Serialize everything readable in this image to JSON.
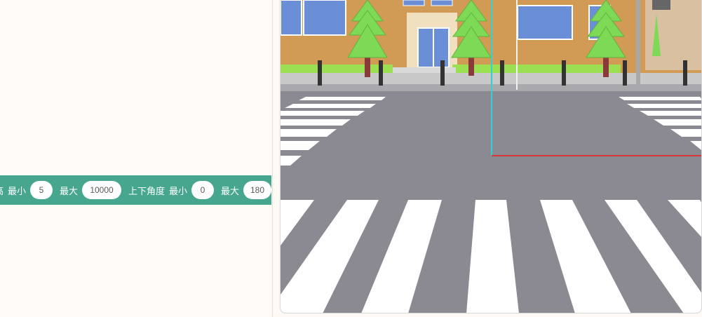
{
  "block": {
    "seg0": "高",
    "seg1": "最小",
    "val1": "5",
    "seg2": "最大",
    "val2": "10000",
    "seg3": "上下角度",
    "seg4": "最小",
    "val3": "0",
    "seg5": "最大",
    "val4": "180"
  },
  "colors": {
    "block_bg": "#47a68e",
    "workspace_bg": "#fffbf7",
    "road": "#8b8a93",
    "building": "#d19a55",
    "tree": "#7ed957",
    "axis_y": "#2bd3d3",
    "axis_x": "#d63a3a"
  },
  "scene": {
    "description_icon": "3d-street-crosswalk-scene"
  }
}
